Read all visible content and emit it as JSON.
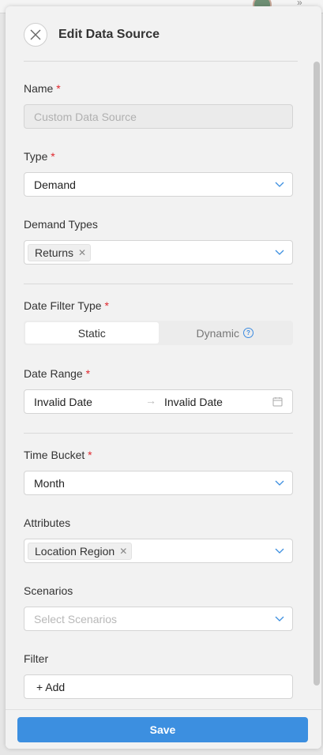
{
  "drawer": {
    "title": "Edit Data Source",
    "save_label": "Save"
  },
  "form": {
    "name": {
      "label": "Name",
      "required_mark": "*",
      "value": "Custom Data Source"
    },
    "type": {
      "label": "Type",
      "required_mark": "*",
      "value": "Demand"
    },
    "demand_types": {
      "label": "Demand Types",
      "tags": [
        "Returns"
      ]
    },
    "date_filter_type": {
      "label": "Date Filter Type",
      "required_mark": "*",
      "options": [
        "Static",
        "Dynamic"
      ],
      "selected": "Static"
    },
    "date_range": {
      "label": "Date Range",
      "required_mark": "*",
      "start": "Invalid Date",
      "end": "Invalid Date"
    },
    "time_bucket": {
      "label": "Time Bucket",
      "required_mark": "*",
      "value": "Month"
    },
    "attributes": {
      "label": "Attributes",
      "tags": [
        "Location Region"
      ]
    },
    "scenarios": {
      "label": "Scenarios",
      "placeholder": "Select Scenarios"
    },
    "filter": {
      "label": "Filter",
      "add_label": "+ Add"
    }
  },
  "colors": {
    "accent": "#3c8fe0",
    "required": "#e0282e"
  },
  "icons": {
    "close": "close-icon",
    "chevron": "chevron-down-icon",
    "tag_remove": "tag-close-icon",
    "help": "question-circle-icon",
    "calendar": "calendar-icon",
    "arrow": "arrow-right-icon"
  }
}
